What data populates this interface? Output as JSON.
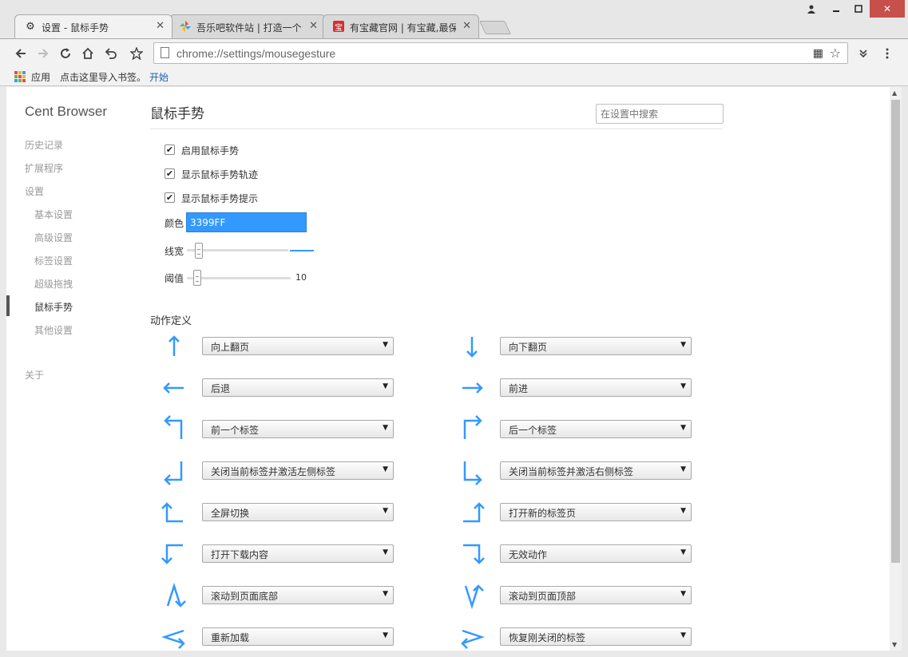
{
  "tabs": [
    {
      "title": "设置 - 鼠标手势",
      "icon": "gear-icon",
      "active": true
    },
    {
      "title": "吾乐吧软件站 | 打造一个",
      "icon": "pinwheel-icon",
      "active": false
    },
    {
      "title": "有宝藏官网 | 有宝藏,最保",
      "icon": "bao-icon",
      "icon_text": "宝",
      "active": false
    }
  ],
  "toolbar": {
    "url": "chrome://settings/mousegesture"
  },
  "bookmarks": {
    "apps_label": "应用",
    "import_label": "点击这里导入书签。",
    "start_link": "开始"
  },
  "sidebar": {
    "brand": "Cent Browser",
    "items": [
      {
        "label": "历史记录",
        "level": 0
      },
      {
        "label": "扩展程序",
        "level": 0
      },
      {
        "label": "设置",
        "level": 0
      },
      {
        "label": "基本设置",
        "level": 1
      },
      {
        "label": "高级设置",
        "level": 1
      },
      {
        "label": "标签设置",
        "level": 1
      },
      {
        "label": "超级拖拽",
        "level": 1
      },
      {
        "label": "鼠标手势",
        "level": 1,
        "selected": true
      },
      {
        "label": "其他设置",
        "level": 1
      },
      {
        "label": "关于",
        "level": 0
      }
    ]
  },
  "main": {
    "title": "鼠标手势",
    "search_placeholder": "在设置中搜索",
    "checkboxes": [
      {
        "label": "启用鼠标手势",
        "checked": true
      },
      {
        "label": "显示鼠标手势轨迹",
        "checked": true
      },
      {
        "label": "显示鼠标手势提示",
        "checked": true
      }
    ],
    "color_label": "颜色",
    "color_value": "3399FF",
    "line_width_label": "线宽",
    "line_width_fraction": 0.12,
    "threshold_label": "阈值",
    "threshold_value": "10",
    "threshold_fraction": 0.1,
    "section_title": "动作定义",
    "gestures": [
      {
        "gesture": "up",
        "action": "向上翻页"
      },
      {
        "gesture": "down",
        "action": "向下翻页"
      },
      {
        "gesture": "left",
        "action": "后退"
      },
      {
        "gesture": "right",
        "action": "前进"
      },
      {
        "gesture": "up-left",
        "action": "前一个标签"
      },
      {
        "gesture": "up-right",
        "action": "后一个标签"
      },
      {
        "gesture": "down-left",
        "action": "关闭当前标签并激活左侧标签"
      },
      {
        "gesture": "down-right",
        "action": "关闭当前标签并激活右侧标签"
      },
      {
        "gesture": "left-up",
        "action": "全屏切换"
      },
      {
        "gesture": "right-up",
        "action": "打开新的标签页"
      },
      {
        "gesture": "left-down",
        "action": "打开下载内容"
      },
      {
        "gesture": "right-down",
        "action": "无效动作"
      },
      {
        "gesture": "up-down",
        "action": "滚动到页面底部"
      },
      {
        "gesture": "down-up",
        "action": "滚动到页面顶部"
      },
      {
        "gesture": "left-right",
        "action": "重新加载"
      },
      {
        "gesture": "right-left",
        "action": "恢复刚关闭的标签"
      }
    ]
  },
  "colors": {
    "accent": "#3399FF",
    "gesture_arrow": "#3399FF",
    "close_button": "#C7504A"
  }
}
